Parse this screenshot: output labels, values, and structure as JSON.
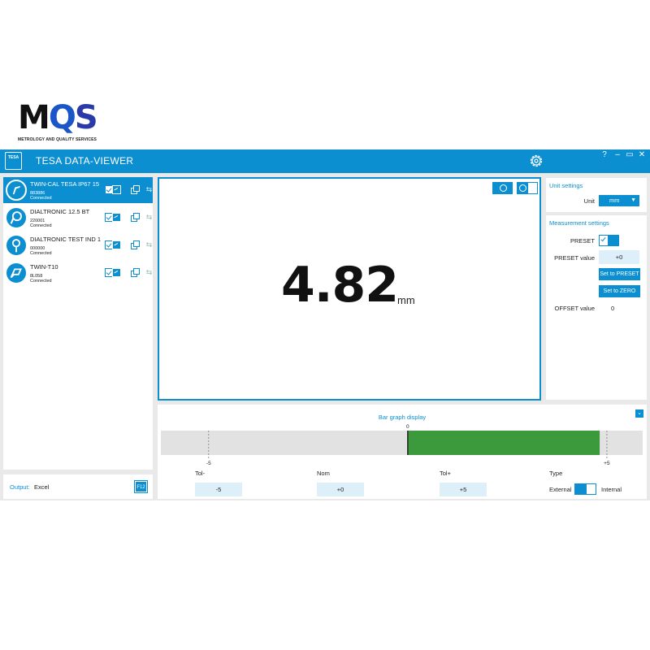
{
  "logo": {
    "text_m": "M",
    "text_o": "Q",
    "text_s": "S",
    "tagline": "METROLOGY AND QUALITY SERVICES"
  },
  "app": {
    "logo_text": "TESA",
    "title": "TESA DATA-VIEWER",
    "help": "?",
    "minimize": "–",
    "restore": "▭",
    "close": "✕"
  },
  "devices": [
    {
      "name": "TWIN-CAL TESA IP67 15",
      "serial": "883886",
      "status": "Connected"
    },
    {
      "name": "DIALTRONIC 12.5 BT",
      "serial": "220001",
      "status": "Connected"
    },
    {
      "name": "DIALTRONIC TEST IND 1",
      "serial": "000000",
      "status": "Connected"
    },
    {
      "name": "TWIN-T10",
      "serial": "8L058",
      "status": "Connected"
    }
  ],
  "device_panel": {
    "add": "+",
    "remove": "−",
    "refresh": "⟳",
    "down": "⌄",
    "up": "⌃"
  },
  "output": {
    "label": "Output:",
    "value": "Excel",
    "f12": "F12"
  },
  "measurement": {
    "value": "4.82",
    "unit": "mm"
  },
  "unit_settings": {
    "title": "Unit settings",
    "unit_label": "Unit",
    "unit_value": "mm"
  },
  "measurement_settings": {
    "title": "Measurement settings",
    "preset_label": "PRESET",
    "preset_value_label": "PRESET value",
    "preset_value": "+0",
    "set_preset": "Set to PRESET",
    "set_zero": "Set to ZERO",
    "offset_label": "OFFSET value",
    "offset_value": "0"
  },
  "bar_graph": {
    "title": "Bar graph display",
    "tol_minus_label": "Tol-",
    "nom_label": "Nom",
    "tol_plus_label": "Tol+",
    "type_label": "Type",
    "tol_minus": "-5",
    "nom": "+0",
    "tol_plus": "+5",
    "type_external": "External",
    "type_internal": "Internal",
    "tick_min": "-5",
    "tick_nom": "0",
    "tick_max": "+5",
    "scale_min": -6.2,
    "scale_max": 5.9,
    "bar_value": 4.82,
    "colors": {
      "bar": "#3c9a3c",
      "track": "#e2e2e2"
    }
  }
}
